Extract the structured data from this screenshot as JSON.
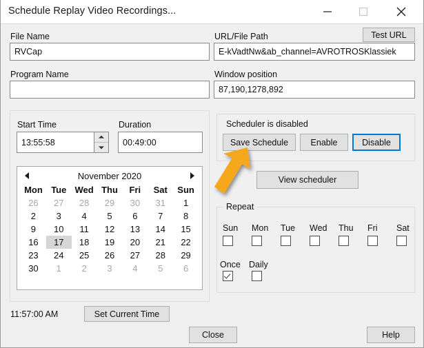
{
  "window": {
    "title": "Schedule Replay Video Recordings...",
    "controls": {
      "minimize": "minimize-icon",
      "maximize": "maximize-icon",
      "close": "close-icon"
    }
  },
  "form": {
    "file_name_label": "File Name",
    "file_name_value": "RVCap",
    "program_name_label": "Program Name",
    "program_name_value": "",
    "url_label": "URL/File Path",
    "url_value": "E-kVadtNw&ab_channel=AVROTROSKlassiek",
    "test_url_button": "Test URL",
    "window_position_label": "Window position",
    "window_position_value": "87,190,1278,892"
  },
  "time_panel": {
    "start_time_label": "Start Time",
    "start_time_value": "13:55:58",
    "duration_label": "Duration",
    "duration_value": "00:49:00"
  },
  "calendar": {
    "month_title": "November 2020",
    "prev_icon": "triangle-left-icon",
    "next_icon": "triangle-right-icon",
    "day_headers": [
      "Mon",
      "Tue",
      "Wed",
      "Thu",
      "Fri",
      "Sat",
      "Sun"
    ],
    "selected_day": 17,
    "weeks": [
      [
        {
          "d": "26",
          "other": true
        },
        {
          "d": "27",
          "other": true
        },
        {
          "d": "28",
          "other": true
        },
        {
          "d": "29",
          "other": true
        },
        {
          "d": "30",
          "other": true
        },
        {
          "d": "31",
          "other": true
        },
        {
          "d": "1",
          "other": false
        }
      ],
      [
        {
          "d": "2",
          "other": false
        },
        {
          "d": "3",
          "other": false
        },
        {
          "d": "4",
          "other": false
        },
        {
          "d": "5",
          "other": false
        },
        {
          "d": "6",
          "other": false
        },
        {
          "d": "7",
          "other": false
        },
        {
          "d": "8",
          "other": false
        }
      ],
      [
        {
          "d": "9",
          "other": false
        },
        {
          "d": "10",
          "other": false
        },
        {
          "d": "11",
          "other": false
        },
        {
          "d": "12",
          "other": false
        },
        {
          "d": "13",
          "other": false
        },
        {
          "d": "14",
          "other": false
        },
        {
          "d": "15",
          "other": false
        }
      ],
      [
        {
          "d": "16",
          "other": false
        },
        {
          "d": "17",
          "other": false,
          "sel": true
        },
        {
          "d": "18",
          "other": false
        },
        {
          "d": "19",
          "other": false
        },
        {
          "d": "20",
          "other": false
        },
        {
          "d": "21",
          "other": false
        },
        {
          "d": "22",
          "other": false
        }
      ],
      [
        {
          "d": "23",
          "other": false
        },
        {
          "d": "24",
          "other": false
        },
        {
          "d": "25",
          "other": false
        },
        {
          "d": "26",
          "other": false
        },
        {
          "d": "27",
          "other": false
        },
        {
          "d": "28",
          "other": false
        },
        {
          "d": "29",
          "other": false
        }
      ],
      [
        {
          "d": "30",
          "other": false
        },
        {
          "d": "1",
          "other": true
        },
        {
          "d": "2",
          "other": true
        },
        {
          "d": "3",
          "other": true
        },
        {
          "d": "4",
          "other": true
        },
        {
          "d": "5",
          "other": true
        },
        {
          "d": "6",
          "other": true
        }
      ]
    ]
  },
  "scheduler": {
    "status_text": "Scheduler is disabled",
    "save_schedule_button": "Save Schedule",
    "enable_button": "Enable",
    "disable_button": "Disable",
    "view_scheduler_button": "View scheduler",
    "focused_button": "Disable"
  },
  "repeat": {
    "group_label": "Repeat",
    "days": [
      {
        "label": "Sun",
        "checked": false
      },
      {
        "label": "Mon",
        "checked": false
      },
      {
        "label": "Tue",
        "checked": false
      },
      {
        "label": "Wed",
        "checked": false
      },
      {
        "label": "Thu",
        "checked": false
      },
      {
        "label": "Fri",
        "checked": false
      },
      {
        "label": "Sat",
        "checked": false
      }
    ],
    "modes": [
      {
        "label": "Once",
        "checked": true
      },
      {
        "label": "Daily",
        "checked": false
      }
    ]
  },
  "footer": {
    "current_time": "11:57:00 AM",
    "set_current_time_button": "Set Current Time",
    "close_button": "Close",
    "help_button": "Help"
  },
  "annotation": {
    "arrow_icon": "arrow-up-right-icon",
    "arrow_color": "#F5A81C",
    "points_at": "Save Schedule"
  },
  "colors": {
    "window_background": "#F0F0F0",
    "titlebar_background": "#FFFFFF",
    "focus_accent": "#0078D7",
    "field_background": "#FFFFFF",
    "button_face": "#E1E1E1",
    "selected_day_background": "#D6D6D6"
  }
}
